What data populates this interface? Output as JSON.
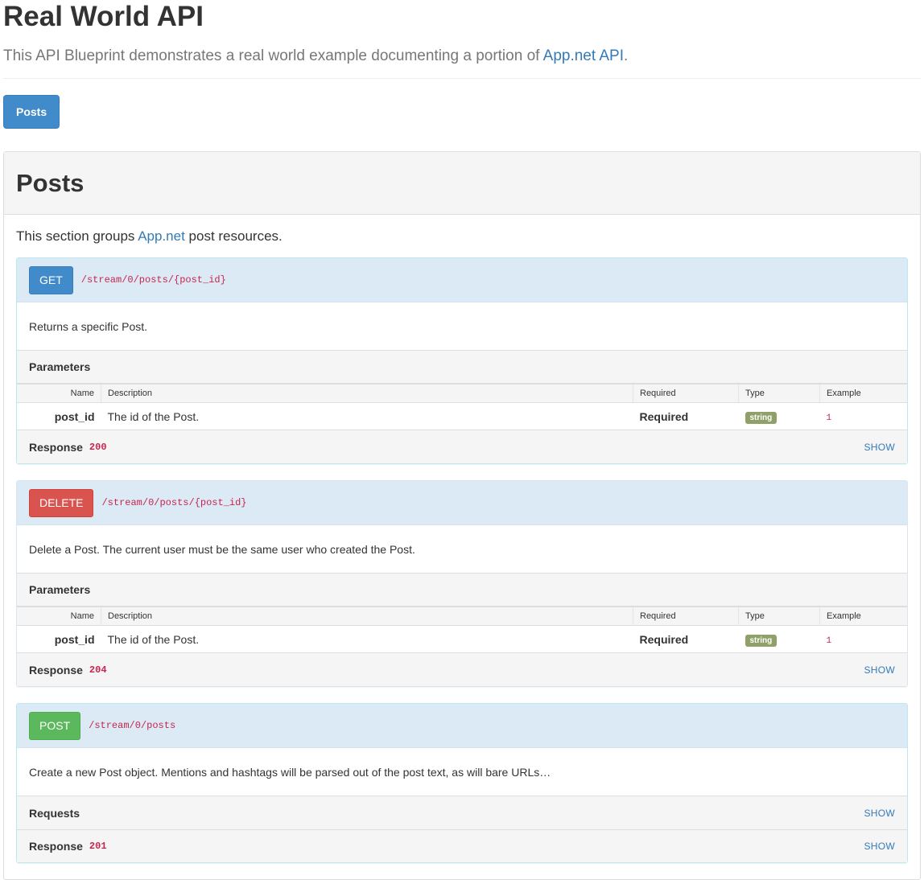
{
  "header": {
    "title": "Real World API",
    "lead_text": "This API Blueprint demonstrates a real world example documenting a portion of ",
    "lead_link": "App.net API",
    "lead_tail": "."
  },
  "nav": {
    "posts_button": "Posts"
  },
  "group": {
    "title": "Posts",
    "desc_prefix": "This section groups ",
    "desc_link": "App.net",
    "desc_suffix": " post resources."
  },
  "param_headers": {
    "name": "Name",
    "description": "Description",
    "required": "Required",
    "type": "Type",
    "example": "Example"
  },
  "actions": [
    {
      "method": "GET",
      "uri": "/stream/0/posts/{post_id}",
      "description": "Returns a specific Post.",
      "parameters_label": "Parameters",
      "param": {
        "name": "post_id",
        "description": "The id of the Post.",
        "required": "Required",
        "type": "string",
        "example": "1"
      },
      "response_label": "Response",
      "response_code": "200",
      "show": "SHOW"
    },
    {
      "method": "DELETE",
      "uri": "/stream/0/posts/{post_id}",
      "description": "Delete a Post. The current user must be the same user who created the Post.",
      "parameters_label": "Parameters",
      "param": {
        "name": "post_id",
        "description": "The id of the Post.",
        "required": "Required",
        "type": "string",
        "example": "1"
      },
      "response_label": "Response",
      "response_code": "204",
      "show": "SHOW"
    },
    {
      "method": "POST",
      "uri": "/stream/0/posts",
      "description": "Create a new Post object. Mentions and hashtags will be parsed out of the post text, as will bare URLs…",
      "requests_label": "Requests",
      "requests_show": "SHOW",
      "response_label": "Response",
      "response_code": "201",
      "show": "SHOW"
    }
  ],
  "colors": {
    "get": "#428bca",
    "delete": "#d9534f",
    "post": "#5cb85c",
    "code": "#c7254e",
    "type_label": "#8fa069"
  }
}
